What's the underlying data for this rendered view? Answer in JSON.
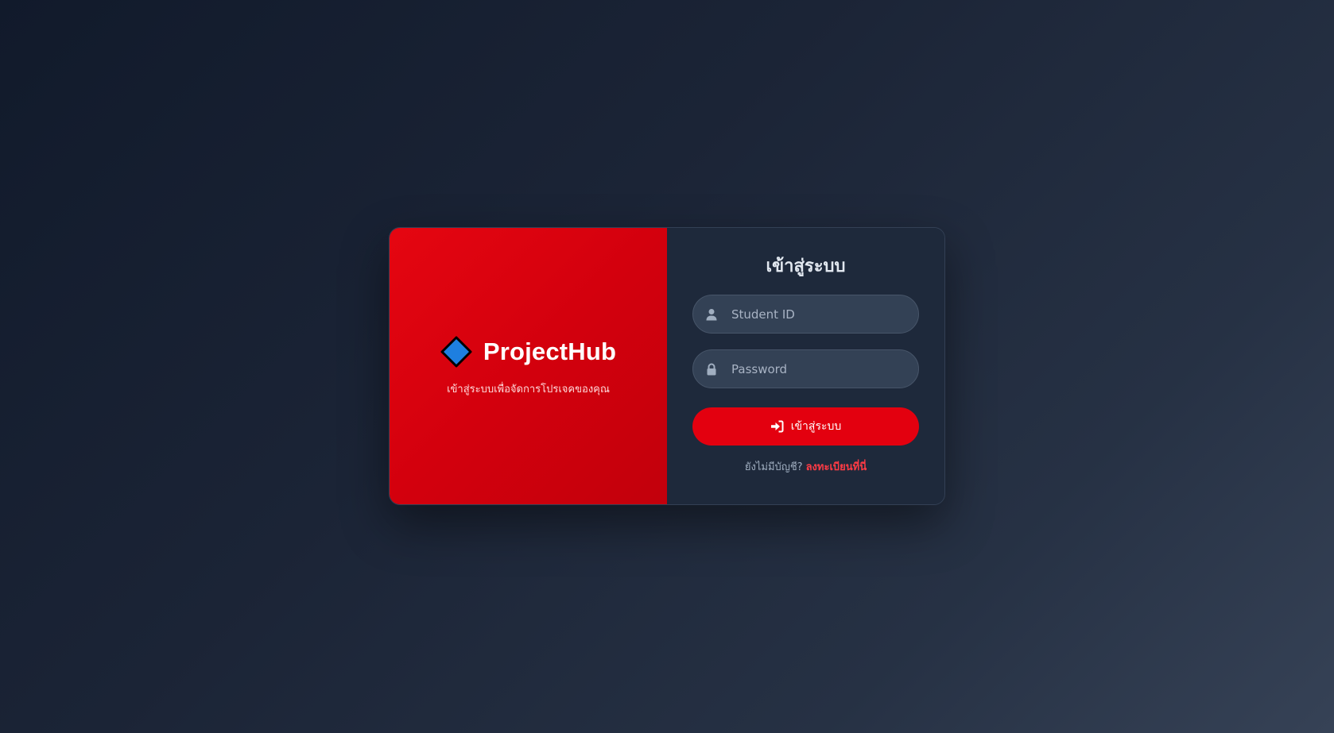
{
  "brand": {
    "name": "ProjectHub",
    "tagline": "เข้าสู่ระบบเพื่อจัดการโปรเจคของคุณ",
    "logo_icon": "blue-diamond-icon"
  },
  "login_form": {
    "title": "เข้าสู่ระบบ",
    "student_id": {
      "value": "",
      "placeholder": "Student ID",
      "icon": "user-icon"
    },
    "password": {
      "value": "",
      "placeholder": "Password",
      "icon": "lock-icon"
    },
    "submit_label": "เข้าสู่ระบบ",
    "submit_icon": "sign-in-icon",
    "register_prompt": "ยังไม่มีบัญชี?",
    "register_link": "ลงทะเบียนที่นี่"
  },
  "colors": {
    "brand_red": "#e3000f",
    "link_red": "#ff3b45",
    "form_bg": "#1e293b",
    "input_bg": "#334155",
    "logo_blue": "#1e7fe0"
  }
}
